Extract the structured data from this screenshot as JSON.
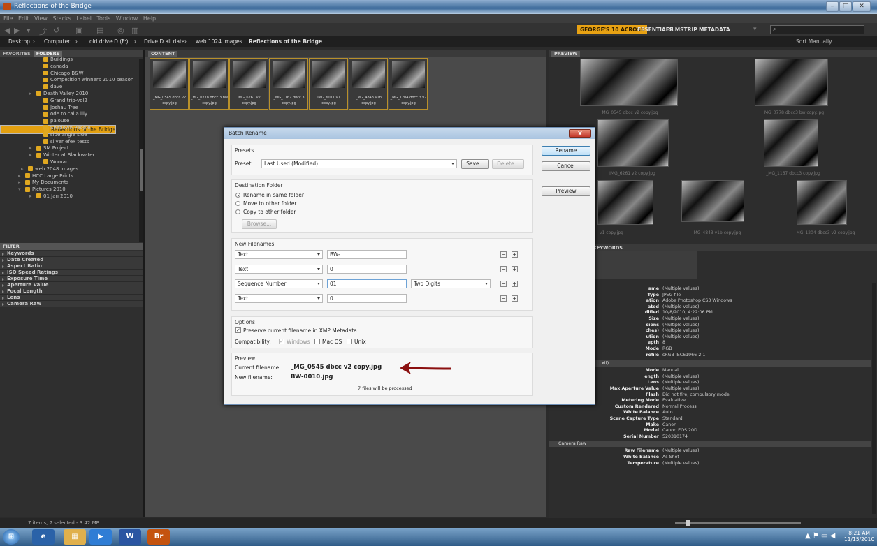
{
  "window": {
    "title": "Reflections of the Bridge"
  },
  "menu": [
    "File",
    "Edit",
    "View",
    "Stacks",
    "Label",
    "Tools",
    "Window",
    "Help"
  ],
  "workspaces": {
    "active": "GEORGE'S 10 ACROSS",
    "items": [
      "ESSENTIALS",
      "FILMSTRIP",
      "METADATA"
    ]
  },
  "path": [
    "Desktop",
    "Computer",
    "old drive D (F:)",
    "Drive D all data",
    "web 1024 images",
    "Reflections of the Bridge"
  ],
  "sort": "Sort Manually",
  "tabs": {
    "favorites": "FAVORITES",
    "folders": "FOLDERS",
    "content": "CONTENT",
    "preview": "PREVIEW",
    "filter": "FILTER",
    "keywords": "KEYWORDS"
  },
  "folders": [
    "Buildings",
    "canada",
    "Chicago B&W",
    "Competition winners 2010 season",
    "dave",
    "Death Valley 2010",
    "Grand trip-vol2",
    "Joshau Tree",
    "ode to calla lily",
    "palouse",
    "Reflections of the Bridge",
    "Shadown People",
    "side angle side",
    "silver efex tests",
    "SM Project",
    "Winter at Blackwater",
    "Woman",
    "web 2048 images",
    "HCC Large Prints",
    "My Documents",
    "Pictures 2010",
    "01 Jan 2010"
  ],
  "filters": [
    "Keywords",
    "Date Created",
    "Aspect Ratio",
    "ISO Speed Ratings",
    "Exposure Time",
    "Aperture Value",
    "Focal Length",
    "Lens",
    "Camera Raw"
  ],
  "thumbs": [
    "_MG_0545 dbcc v2 copy.jpg",
    "_MG_0778 dbcc 3 bw copy.jpg",
    "IMG_6261 v2 copy.jpg",
    "_MG_1167 dbcc 3 copy.jpg",
    "IMG_6011 v1 copy.jpg",
    "_MG_4843 v1b copy.jpg",
    "_MG_1204 dbcc 3 v2 copy.jpg"
  ],
  "preview_labels": [
    "_MG_0545 dbcc v2 copy.jpg",
    "_MG_0778 dbcc3 bw copy.jpg",
    "IMG_6261 v2 copy.jpg",
    "_MG_1167 dbcc3 copy.jpg",
    "v1 copy.jpg",
    "_MG_4843 v1b copy.jpg",
    "_MG_1204 dbcc3 v2 copy.jpg"
  ],
  "metadata": [
    {
      "k": "ame",
      "v": "(Multiple values)"
    },
    {
      "k": "Type",
      "v": "JPEG file"
    },
    {
      "k": "ation",
      "v": "Adobe Photoshop CS3 Windows"
    },
    {
      "k": "ated",
      "v": "(Multiple values)"
    },
    {
      "k": "dified",
      "v": "10/8/2010, 4:22:06 PM"
    },
    {
      "k": "Size",
      "v": "(Multiple values)"
    },
    {
      "k": "sions",
      "v": "(Multiple values)"
    },
    {
      "k": "ches)",
      "v": "(Multiple values)"
    },
    {
      "k": "ution",
      "v": "(Multiple values)"
    },
    {
      "k": "epth",
      "v": "8"
    },
    {
      "k": "Mode",
      "v": "RGB"
    },
    {
      "k": "rofile",
      "v": "sRGB IEC61966-2.1"
    }
  ],
  "exif_header": "xif)",
  "exif": [
    {
      "k": "Mode",
      "v": "Manual"
    },
    {
      "k": "ength",
      "v": "(Multiple values)"
    },
    {
      "k": "Lens",
      "v": "(Multiple values)"
    },
    {
      "k": "Max Aperture Value",
      "v": "(Multiple values)"
    },
    {
      "k": "Flash",
      "v": "Did not fire, compulsory mode"
    },
    {
      "k": "Metering Mode",
      "v": "Evaluative"
    },
    {
      "k": "Custom Rendered",
      "v": "Normal Process"
    },
    {
      "k": "White Balance",
      "v": "Auto"
    },
    {
      "k": "Scene Capture Type",
      "v": "Standard"
    },
    {
      "k": "Make",
      "v": "Canon"
    },
    {
      "k": "Model",
      "v": "Canon EOS 20D"
    },
    {
      "k": "Serial Number",
      "v": "520310174"
    }
  ],
  "camera_raw": {
    "header": "Camera Raw",
    "rows": [
      {
        "k": "Raw Filename",
        "v": "(Multiple values)"
      },
      {
        "k": "White Balance",
        "v": "As Shot"
      },
      {
        "k": "Temperature",
        "v": "(Multiple values)"
      }
    ]
  },
  "status": "7 items, 7 selected - 3.42 MB",
  "clock": {
    "time": "8:21 AM",
    "date": "11/15/2010"
  },
  "dialog": {
    "title": "Batch Rename",
    "close": "X",
    "presets": {
      "title": "Presets",
      "label": "Preset:",
      "value": "Last Used (Modified)",
      "save": "Save...",
      "delete": "Delete..."
    },
    "buttons": {
      "rename": "Rename",
      "cancel": "Cancel",
      "preview": "Preview"
    },
    "dest": {
      "title": "Destination Folder",
      "opt1": "Rename in same folder",
      "opt2": "Move to other folder",
      "opt3": "Copy to other folder",
      "browse": "Browse..."
    },
    "filenames": {
      "title": "New Filenames",
      "rows": [
        {
          "type": "Text",
          "value": "BW-",
          "extra": ""
        },
        {
          "type": "Text",
          "value": "0",
          "extra": ""
        },
        {
          "type": "Sequence Number",
          "value": "01",
          "extra": "Two Digits"
        },
        {
          "type": "Text",
          "value": "0",
          "extra": ""
        }
      ]
    },
    "options": {
      "title": "Options",
      "preserve": "Preserve current filename in XMP Metadata",
      "compat": "Compatibility:",
      "windows": "Windows",
      "mac": "Mac OS",
      "unix": "Unix"
    },
    "preview": {
      "title": "Preview",
      "current_label": "Current filename:",
      "current": "_MG_0545 dbcc v2 copy.jpg",
      "new_label": "New filename:",
      "new": "BW-0010.jpg",
      "count": "7 files will be processed"
    }
  }
}
